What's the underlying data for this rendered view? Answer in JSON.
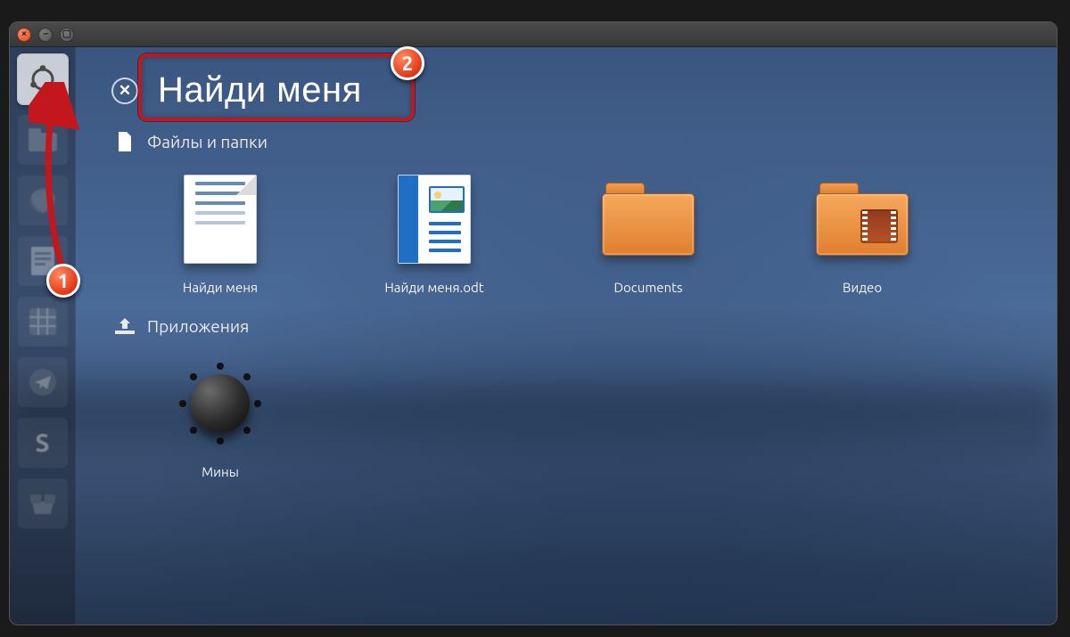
{
  "callouts": {
    "one": "1",
    "two": "2"
  },
  "search": {
    "value": "Найди меня"
  },
  "sections": {
    "files": {
      "title": "Файлы и папки"
    },
    "apps": {
      "title": "Приложения"
    }
  },
  "results": {
    "files": [
      {
        "label": "Найди меня"
      },
      {
        "label": "Найди меня.odt"
      },
      {
        "label": "Documents"
      },
      {
        "label": "Видео"
      }
    ],
    "apps": [
      {
        "label": "Мины"
      }
    ]
  },
  "launcher": {
    "items": [
      {
        "name": "dash-home"
      },
      {
        "name": "files-app"
      },
      {
        "name": "firefox-app"
      },
      {
        "name": "libreoffice-app"
      },
      {
        "name": "spreadsheet-app"
      },
      {
        "name": "telegram-app"
      },
      {
        "name": "skype-app"
      },
      {
        "name": "software-app"
      }
    ]
  }
}
